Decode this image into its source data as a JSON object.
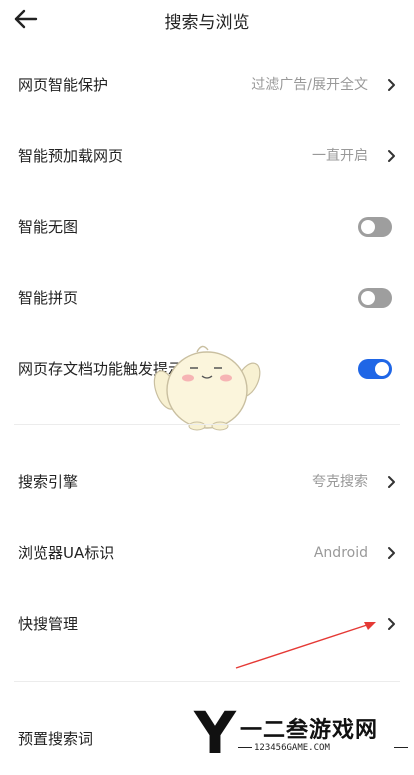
{
  "header": {
    "title": "搜索与浏览",
    "back_icon": "arrow-left-icon"
  },
  "settings": {
    "page_protection": {
      "label": "网页智能保护",
      "value": "过滤广告/展开全文"
    },
    "smart_preload": {
      "label": "智能预加载网页",
      "value": "一直开启"
    },
    "smart_no_image": {
      "label": "智能无图",
      "state": "off"
    },
    "smart_page_merge": {
      "label": "智能拼页",
      "state": "off"
    },
    "archive_hint": {
      "label": "网页存文档功能触发提示",
      "state": "on"
    },
    "search_engine": {
      "label": "搜索引擎",
      "value": "夸克搜索"
    },
    "ua_identity": {
      "label": "浏览器UA标识",
      "value": "Android"
    },
    "quick_search": {
      "label": "快搜管理"
    },
    "preset_keywords": {
      "label": "预置搜索词"
    }
  },
  "colors": {
    "toggle_on": "#1f66e6",
    "toggle_off": "#9e9e9e",
    "annotation_arrow": "#e53935"
  },
  "watermark": {
    "brand": "一二叁游戏网",
    "url": "123456GAME.COM"
  }
}
